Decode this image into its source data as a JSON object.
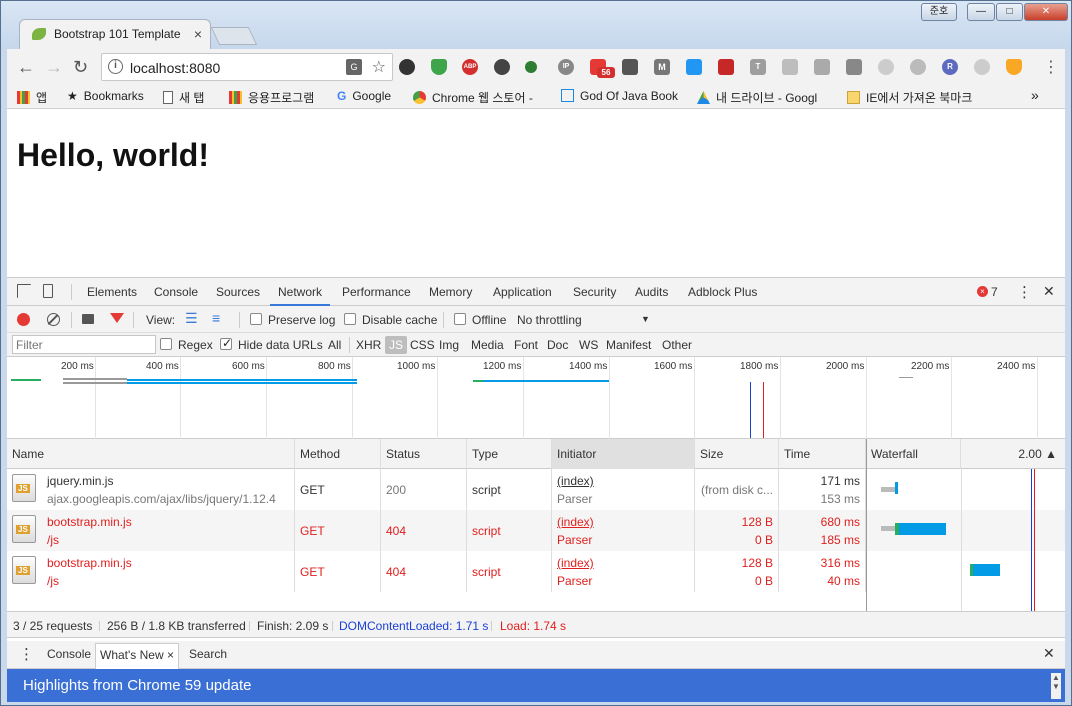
{
  "window": {
    "user_label": "준호",
    "min": "—",
    "max": "□",
    "close": "✕"
  },
  "tab": {
    "title": "Bootstrap 101 Template",
    "close": "×"
  },
  "omnibox": {
    "url": "localhost:8080",
    "info": "i",
    "star": "☆",
    "translate": "G"
  },
  "extensions": {
    "abp": "ABP",
    "badge_count": "56",
    "ip": "IP",
    "r": "R",
    "t": "T",
    "m": "M"
  },
  "bookmarks": [
    {
      "label": "앱"
    },
    {
      "label": "Bookmarks"
    },
    {
      "label": "새 탭"
    },
    {
      "label": "응용프로그램"
    },
    {
      "label": "Google"
    },
    {
      "label": "Chrome 웹 스토어 -"
    },
    {
      "label": "God Of Java Book"
    },
    {
      "label": "내 드라이브 - Googl"
    },
    {
      "label": "IE에서 가져온 북마크"
    }
  ],
  "bookmarks_more": "»",
  "page": {
    "heading": "Hello, world!"
  },
  "devtools": {
    "tabs": [
      "Elements",
      "Console",
      "Sources",
      "Network",
      "Performance",
      "Memory",
      "Application",
      "Security",
      "Audits",
      "Adblock Plus"
    ],
    "error_count": "7",
    "error_x": "×",
    "menu": "⋮",
    "close": "✕",
    "netbar": {
      "view_label": "View:",
      "preserve_log": "Preserve log",
      "disable_cache": "Disable cache",
      "offline": "Offline",
      "throttling": "No throttling",
      "dropdown": "▼"
    },
    "filterbar": {
      "placeholder": "Filter",
      "regex": "Regex",
      "hide_data_urls": "Hide data URLs",
      "all": "All",
      "types": [
        "XHR",
        "JS",
        "CSS",
        "Img",
        "Media",
        "Font",
        "Doc",
        "WS",
        "Manifest",
        "Other"
      ],
      "active_type": "JS"
    },
    "overview_ticks": [
      "200 ms",
      "400 ms",
      "600 ms",
      "800 ms",
      "1000 ms",
      "1200 ms",
      "1400 ms",
      "1600 ms",
      "1800 ms",
      "2000 ms",
      "2200 ms",
      "2400 ms"
    ],
    "columns": [
      "Name",
      "Method",
      "Status",
      "Type",
      "Initiator",
      "Size",
      "Time",
      "Waterfall",
      "2.00 ▲"
    ],
    "rows": [
      {
        "name": "jquery.min.js",
        "path": "ajax.googleapis.com/ajax/libs/jquery/1.12.4",
        "method": "GET",
        "status": "200",
        "type": "script",
        "initiator": "(index)",
        "initiator_sub": "Parser",
        "size": "(from disk c...",
        "size_sub": "",
        "time": "171 ms",
        "time_sub": "153 ms",
        "error": false
      },
      {
        "name": "bootstrap.min.js",
        "path": "/js",
        "method": "GET",
        "status": "404",
        "type": "script",
        "initiator": "(index)",
        "initiator_sub": "Parser",
        "size": "128 B",
        "size_sub": "0 B",
        "time": "680 ms",
        "time_sub": "185 ms",
        "error": true
      },
      {
        "name": "bootstrap.min.js",
        "path": "/js",
        "method": "GET",
        "status": "404",
        "type": "script",
        "initiator": "(index)",
        "initiator_sub": "Parser",
        "size": "128 B",
        "size_sub": "0 B",
        "time": "316 ms",
        "time_sub": "40 ms",
        "error": true
      }
    ],
    "file_icon_label": "JS",
    "status": {
      "requests": "3 / 25 requests",
      "transferred": "256 B / 1.8 KB transferred",
      "finish": "Finish: 2.09 s",
      "dom_content_loaded": "DOMContentLoaded: 1.71 s",
      "load": "Load: 1.74 s",
      "dcl_color": "#1a3fd6",
      "load_color": "#e0201f"
    },
    "drawer": {
      "tabs": [
        "Console",
        "What's New",
        "Search"
      ],
      "active_tab_close": "×",
      "highlights": "Highlights from Chrome 59 update",
      "close": "✕"
    }
  }
}
